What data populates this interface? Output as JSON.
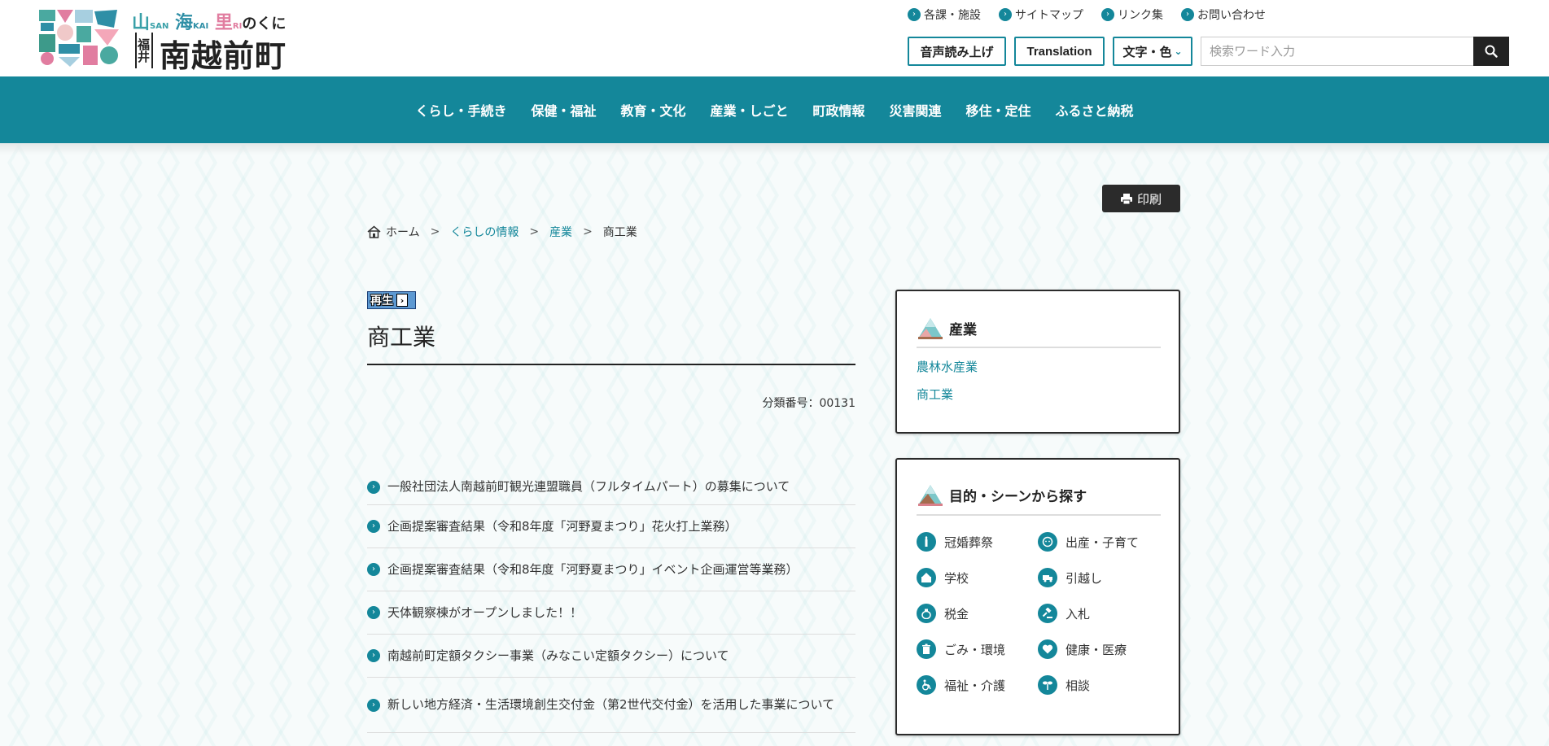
{
  "logo": {
    "tag_san": "山",
    "tag_san_ruby": "SAN",
    "tag_kai": "海",
    "tag_kai_ruby": "KAI",
    "tag_ri": "里",
    "tag_ri_ruby": "RI",
    "tag_suffix": "のくに",
    "prefecture": "福井",
    "town": "南越前町"
  },
  "util_links": [
    "各課・施設",
    "サイトマップ",
    "リンク集",
    "お問い合わせ"
  ],
  "tools": {
    "voice_label": "音声読み上げ",
    "translation_label": "Translation",
    "color_label": "文字・色"
  },
  "search": {
    "placeholder": "検索ワード入力"
  },
  "gnav": [
    "くらし・手続き",
    "保健・福祉",
    "教育・文化",
    "産業・しごと",
    "町政情報",
    "災害関連",
    "移住・定住",
    "ふるさと納税"
  ],
  "print_label": "印刷",
  "breadcrumb": {
    "home": "ホーム",
    "sep": ">",
    "level1": "くらしの情報",
    "level2": "産業",
    "current": "商工業"
  },
  "play": {
    "label": "再生"
  },
  "page": {
    "title": "商工業",
    "class_number": "分類番号：00131"
  },
  "articles": [
    "一般社団法人南越前町観光連盟職員（フルタイムパート）の募集について",
    "企画提案審査結果（令和8年度「河野夏まつり」花火打上業務）",
    "企画提案審査結果（令和8年度「河野夏まつり」イベント企画運営等業務）",
    "天体観察棟がオープンしました！！",
    "南越前町定額タクシー事業（みなこい定額タクシー）について",
    "新しい地方経済・生活環境創生交付金（第2世代交付金）を活用した事業について"
  ],
  "sidebar": {
    "industry": {
      "heading": "産業",
      "links": [
        "農林水産業",
        "商工業"
      ]
    },
    "scenes": {
      "heading": "目的・シーンから探す",
      "items": [
        {
          "label": "冠婚葬祭",
          "icon": "candle-icon"
        },
        {
          "label": "出産・子育て",
          "icon": "baby-icon"
        },
        {
          "label": "学校",
          "icon": "school-icon"
        },
        {
          "label": "引越し",
          "icon": "truck-icon"
        },
        {
          "label": "税金",
          "icon": "money-bag-icon"
        },
        {
          "label": "入札",
          "icon": "gavel-icon"
        },
        {
          "label": "ごみ・環境",
          "icon": "trash-icon"
        },
        {
          "label": "健康・医療",
          "icon": "heart-icon"
        },
        {
          "label": "福祉・介護",
          "icon": "wheelchair-icon"
        },
        {
          "label": "相談",
          "icon": "sprout-icon"
        }
      ]
    }
  },
  "colors": {
    "brand_teal": "#14879a",
    "dark": "#2b2b2b"
  }
}
